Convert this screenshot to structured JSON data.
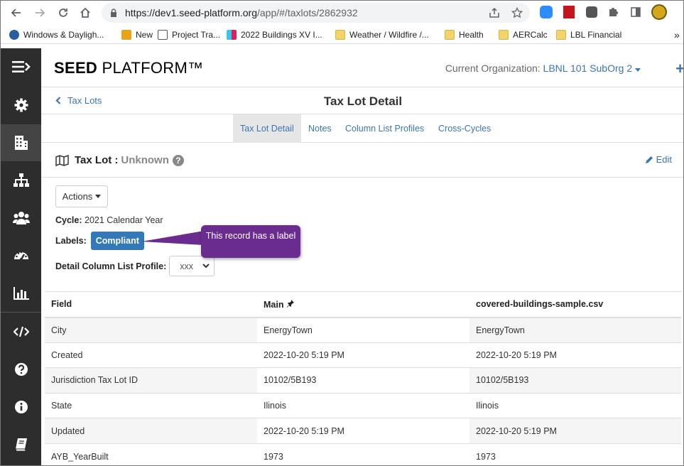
{
  "browser": {
    "url_host": "https://dev1.seed-platform.org",
    "url_path": "/app/#/taxlots/2862932",
    "bookmarks": [
      {
        "label": "Windows & Dayligh...",
        "icon": "eta-icon"
      },
      {
        "label": "New",
        "icon": "stack-icon"
      },
      {
        "label": "Project Tra...",
        "icon": "page-icon"
      },
      {
        "label": "2022 Buildings XV I...",
        "icon": "slack-icon"
      },
      {
        "label": "Weather / Wildfire /...",
        "icon": "folder-icon"
      },
      {
        "label": "Health",
        "icon": "folder-icon"
      },
      {
        "label": "AERCalc",
        "icon": "folder-icon"
      },
      {
        "label": "LBL Financial",
        "icon": "folder-icon"
      }
    ],
    "more": "»"
  },
  "header": {
    "brand_bold": "SEED",
    "brand_rest": " PLATFORM™",
    "org_label": "Current Organization: ",
    "org_name": "LBNL 101 SubOrg 2",
    "plus": "+"
  },
  "titlebar": {
    "back_label": "Tax Lots",
    "title": "Tax Lot Detail"
  },
  "tabs": [
    {
      "label": "Tax Lot Detail",
      "active": true
    },
    {
      "label": "Notes"
    },
    {
      "label": "Column List Profiles"
    },
    {
      "label": "Cross-Cycles"
    }
  ],
  "section": {
    "title": "Tax Lot :",
    "status": "Unknown",
    "help": "?",
    "edit": "Edit"
  },
  "detail": {
    "actions": "Actions",
    "cycle_label": "Cycle:",
    "cycle_value": " 2021 Calendar Year",
    "labels_label": "Labels:",
    "label_badge": "Compliant",
    "profile_label": "Detail Column List Profile:",
    "profile_value": "xxx"
  },
  "callout": {
    "text": "This record has a label"
  },
  "table": {
    "headers": [
      "Field",
      "Main",
      "covered-buildings-sample.csv"
    ],
    "rows": [
      [
        "City",
        "EnergyTown",
        "EnergyTown"
      ],
      [
        "Created",
        "2022-10-20 5:19 PM",
        "2022-10-20 5:19 PM"
      ],
      [
        "Jurisdiction Tax Lot ID",
        "10102/5B193",
        "10102/5B193"
      ],
      [
        "State",
        "Ilinois",
        "Ilinois"
      ],
      [
        "Updated",
        "2022-10-20 5:19 PM",
        "2022-10-20 5:19 PM"
      ],
      [
        "AYB_YearBuilt",
        "1973",
        "1973"
      ]
    ]
  },
  "colors": {
    "link": "#3a76b5",
    "sidebar": "#2d2d2d",
    "badge": "#3479b7",
    "callout": "#6b2c8f"
  }
}
